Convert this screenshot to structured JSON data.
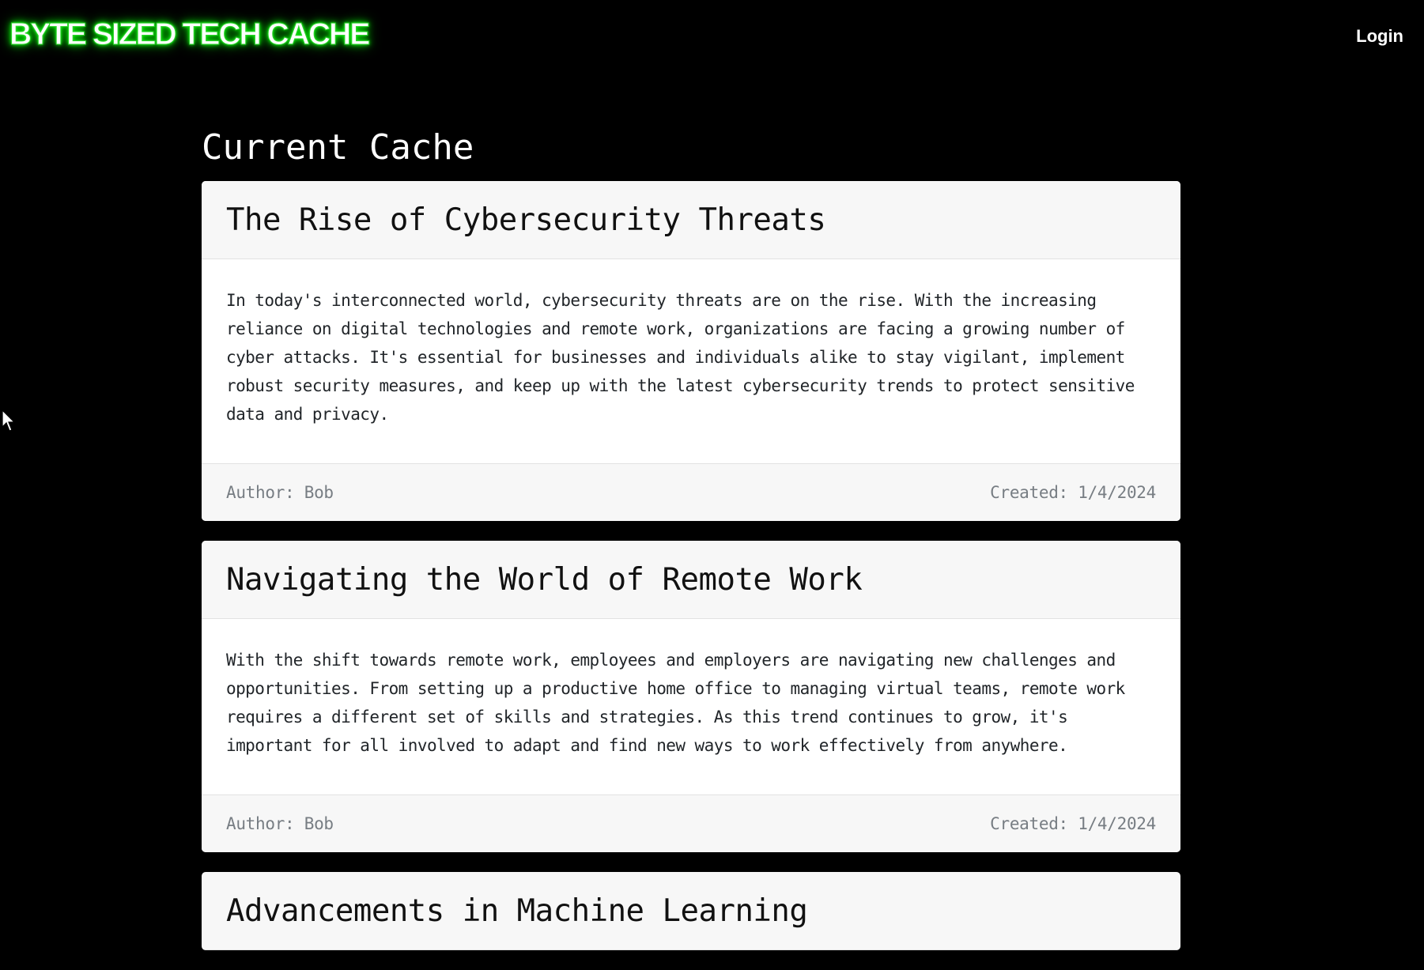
{
  "header": {
    "brand": "BYTE SIZED TECH CACHE",
    "login_label": "Login"
  },
  "main": {
    "title": "Current Cache",
    "posts": [
      {
        "title": "The Rise of Cybersecurity Threats",
        "body": "In today's interconnected world, cybersecurity threats are on the rise. With the increasing reliance on digital technologies and remote work, organizations are facing a growing number of cyber attacks. It's essential for businesses and individuals alike to stay vigilant, implement robust security measures, and keep up with the latest cybersecurity trends to protect sensitive data and privacy.",
        "author": "Author: Bob",
        "created": "Created: 1/4/2024"
      },
      {
        "title": "Navigating the World of Remote Work",
        "body": "With the shift towards remote work, employees and employers are navigating new challenges and opportunities. From setting up a productive home office to managing virtual teams, remote work requires a different set of skills and strategies. As this trend continues to grow, it's important for all involved to adapt and find new ways to work effectively from anywhere.",
        "author": "Author: Bob",
        "created": "Created: 1/4/2024"
      },
      {
        "title": "Advancements in Machine Learning"
      }
    ]
  },
  "colors": {
    "background": "#000000",
    "brand_glow": "#00e600",
    "card_header": "#f7f7f7",
    "muted_text": "#777d83"
  },
  "icons": {
    "cursor": "mouse-pointer-icon"
  }
}
